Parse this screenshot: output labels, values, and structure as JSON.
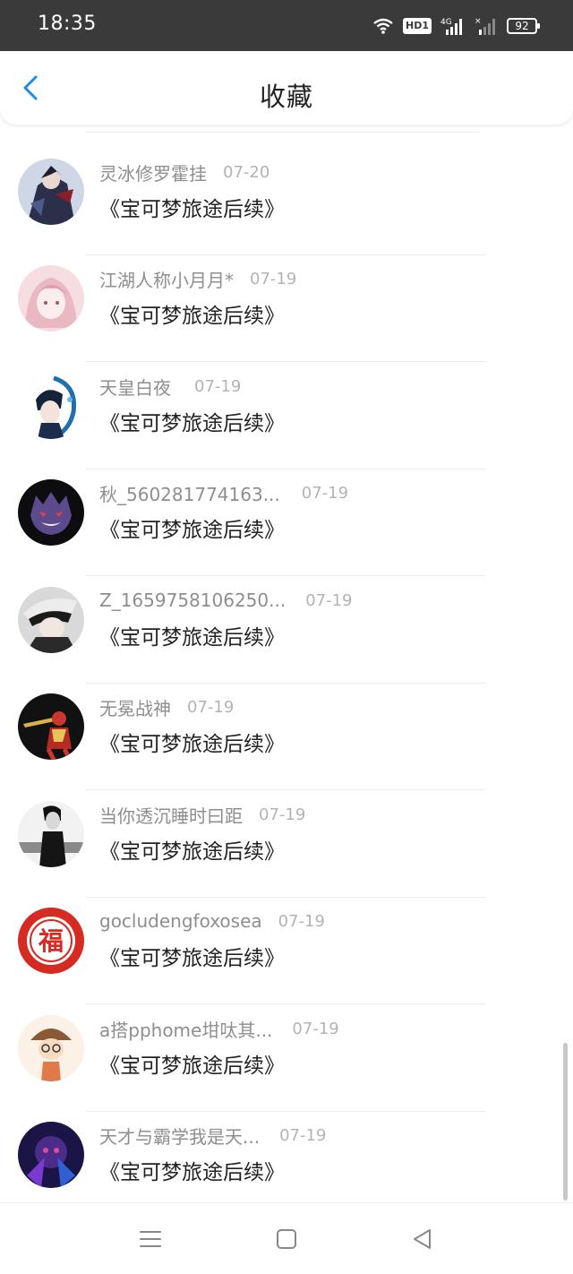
{
  "status_bar": {
    "time": "18:35",
    "hd_label": "HD1",
    "signal_label": "4G",
    "battery": "92",
    "icons": [
      "wifi-icon",
      "hd-icon",
      "signal-4g-icon",
      "signal-icon",
      "battery-icon"
    ]
  },
  "header": {
    "title": "收藏",
    "back_icon": "chevron-left-icon",
    "accent_color": "#1a8de6"
  },
  "items": [
    {
      "user": "灵冰修罗霍挂",
      "date": "07-20",
      "title": "《宝可梦旅途后续》",
      "avatar": "avatar-dark-anime"
    },
    {
      "user": "江湖人称小月月*",
      "date": "07-19",
      "title": "《宝可梦旅途后续》",
      "avatar": "avatar-pink-anime"
    },
    {
      "user": "天皇白夜",
      "date": "07-19",
      "title": "《宝可梦旅途后续》",
      "avatar": "avatar-blue-anime"
    },
    {
      "user": "秋_560281774163...",
      "date": "07-19",
      "title": "《宝可梦旅途后续》",
      "avatar": "avatar-ghost"
    },
    {
      "user": "Z_1659758106250...",
      "date": "07-19",
      "title": "《宝可梦旅途后续》",
      "avatar": "avatar-hat-character"
    },
    {
      "user": "无冕战神",
      "date": "07-19",
      "title": "《宝可梦旅途后续》",
      "avatar": "avatar-warrior"
    },
    {
      "user": "当你透沉睡时曰距",
      "date": "07-19",
      "title": "《宝可梦旅途后续》",
      "avatar": "avatar-bw-photo"
    },
    {
      "user": "gocludengfoxosea",
      "date": "07-19",
      "title": "《宝可梦旅途后续》",
      "avatar": "avatar-fu-seal",
      "avatar_text": "福"
    },
    {
      "user": "a搭pphome坩呔其...",
      "date": "07-19",
      "title": "《宝可梦旅途后续》",
      "avatar": "avatar-cartoon-boy"
    },
    {
      "user": "天才与霸学我是天...",
      "date": "07-19",
      "title": "《宝可梦旅途后续》",
      "avatar": "avatar-purple-art"
    }
  ],
  "nav_bar": {
    "icons": [
      "menu-icon",
      "home-square-icon",
      "back-triangle-icon"
    ]
  }
}
